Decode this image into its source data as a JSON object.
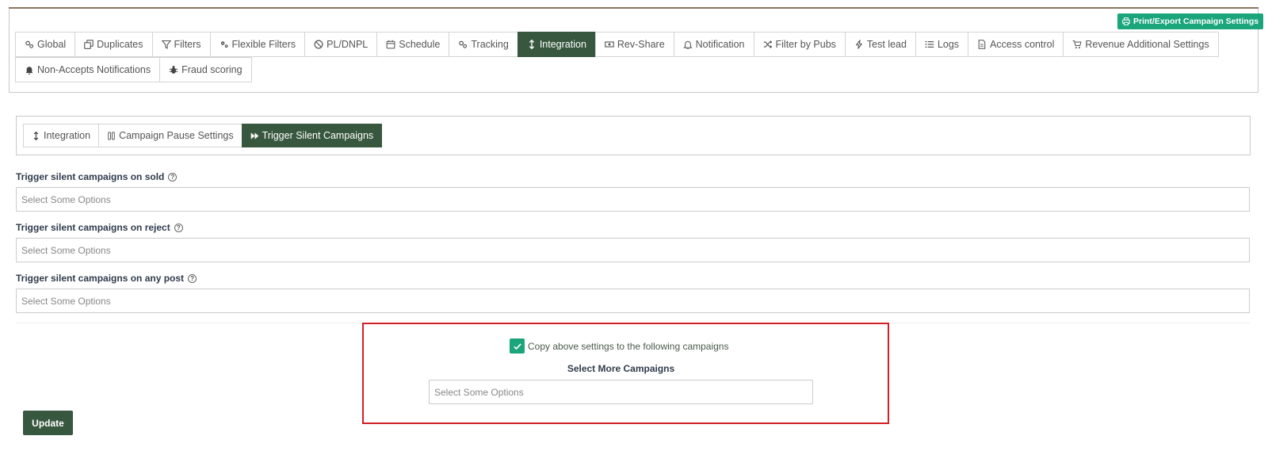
{
  "header": {
    "export_label": "Print/Export Campaign Settings"
  },
  "main_tabs": [
    {
      "label": "Global",
      "icon": "gears-icon"
    },
    {
      "label": "Duplicates",
      "icon": "copy-icon"
    },
    {
      "label": "Filters",
      "icon": "funnel-icon"
    },
    {
      "label": "Flexible Filters",
      "icon": "gears-icon"
    },
    {
      "label": "PL/DNPL",
      "icon": "ban-icon"
    },
    {
      "label": "Schedule",
      "icon": "calendar-icon"
    },
    {
      "label": "Tracking",
      "icon": "gears-icon"
    },
    {
      "label": "Integration",
      "icon": "arrows-vertical-icon",
      "active": true
    },
    {
      "label": "Rev-Share",
      "icon": "money-icon"
    },
    {
      "label": "Notification",
      "icon": "bell-icon"
    },
    {
      "label": "Filter by Pubs",
      "icon": "shuffle-icon"
    },
    {
      "label": "Test lead",
      "icon": "bolt-icon"
    },
    {
      "label": "Logs",
      "icon": "list-icon"
    },
    {
      "label": "Access control",
      "icon": "document-icon"
    },
    {
      "label": "Revenue Additional Settings",
      "icon": "cart-icon"
    },
    {
      "label": "Non-Accepts Notifications",
      "icon": "bell-filled-icon"
    },
    {
      "label": "Fraud scoring",
      "icon": "bug-icon"
    }
  ],
  "sub_tabs": [
    {
      "label": "Integration",
      "icon": "arrows-vertical-icon"
    },
    {
      "label": "Campaign Pause Settings",
      "icon": "pause-icon"
    },
    {
      "label": "Trigger Silent Campaigns",
      "icon": "fast-forward-icon",
      "active": true
    }
  ],
  "fields": [
    {
      "label": "Trigger silent campaigns on sold",
      "placeholder": "Select Some Options"
    },
    {
      "label": "Trigger silent campaigns on reject",
      "placeholder": "Select Some Options"
    },
    {
      "label": "Trigger silent campaigns on any post",
      "placeholder": "Select Some Options"
    }
  ],
  "copy_settings": {
    "checked": true,
    "label": "Copy above settings to the following campaigns",
    "more_label": "Select More Campaigns",
    "placeholder": "Select Some Options"
  },
  "update_label": "Update",
  "help_glyph": "?",
  "colors": {
    "primary_dark": "#38573f",
    "accent_green": "#1aa57a",
    "highlight_red": "#d31f26"
  }
}
